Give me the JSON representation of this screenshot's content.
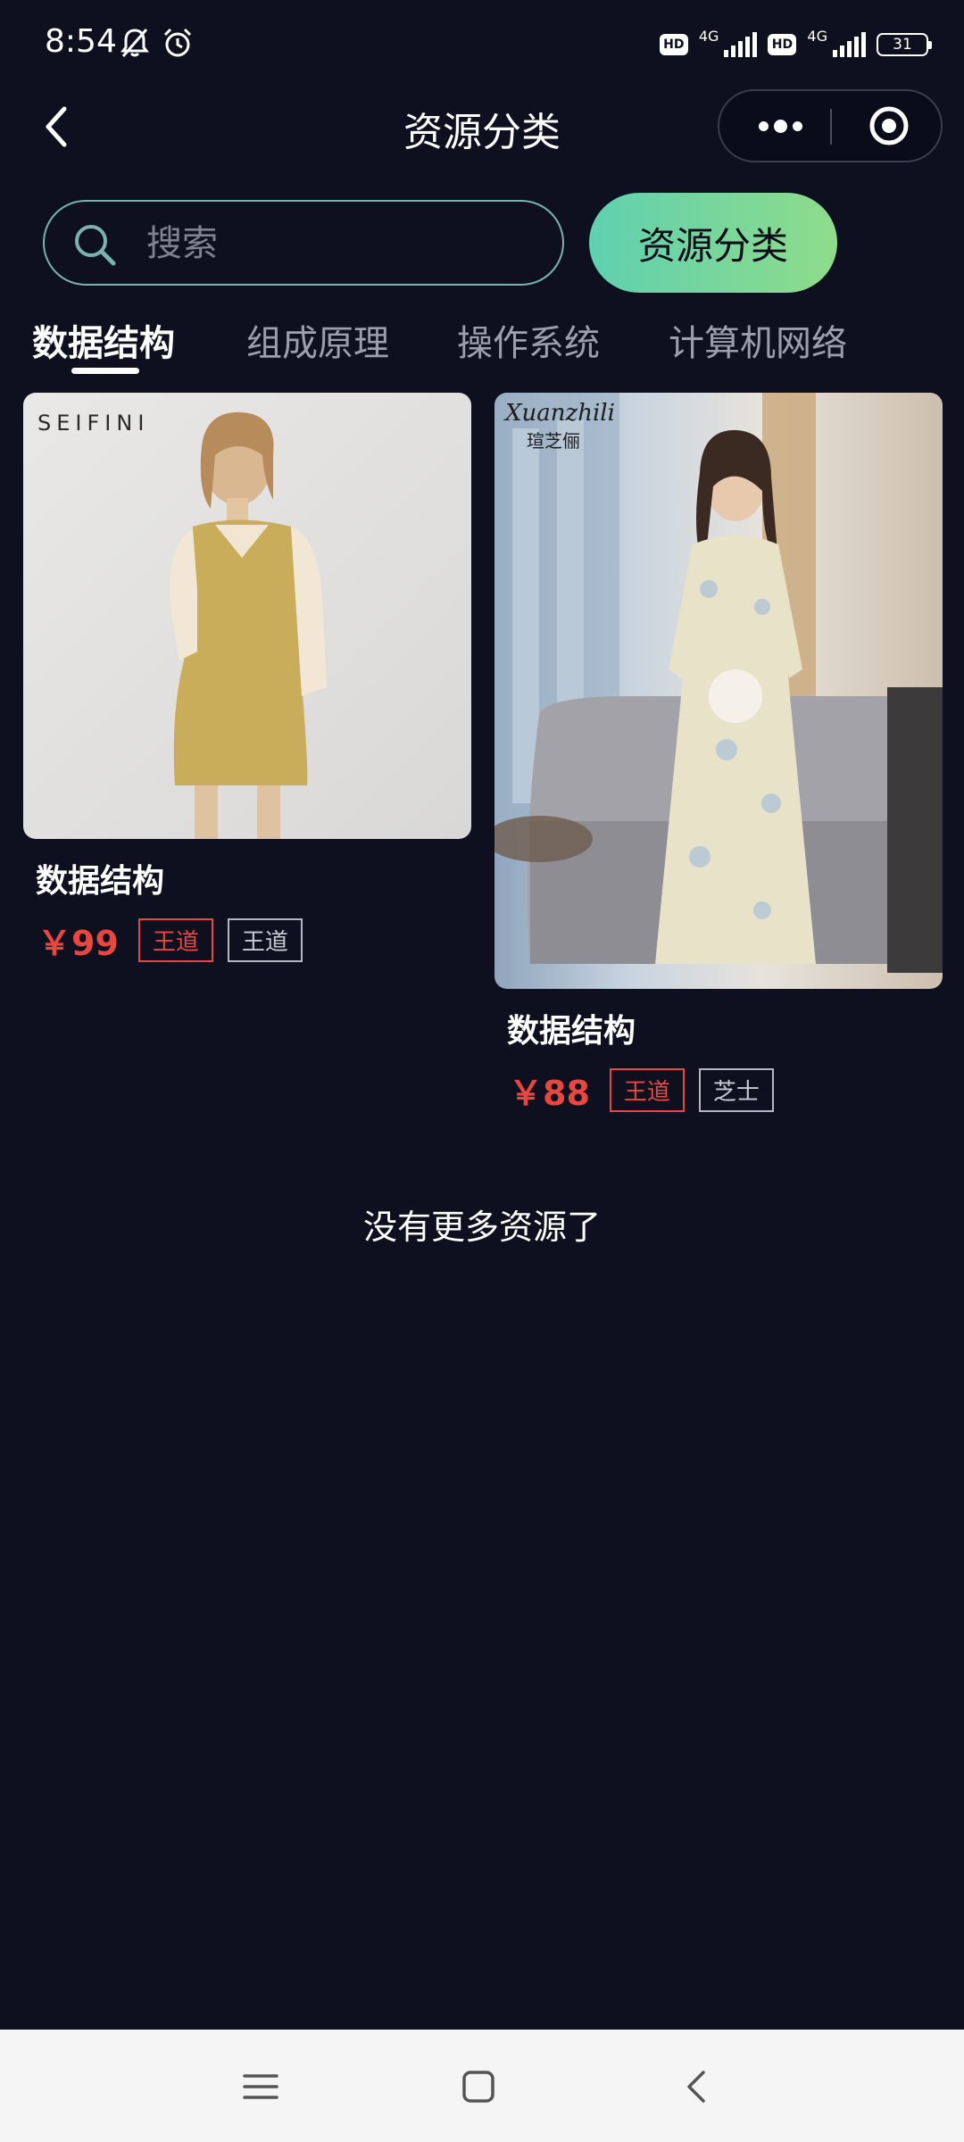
{
  "status_bar": {
    "time": "8:54",
    "network_1": "4G",
    "network_2": "4G",
    "hd_1": "HD",
    "hd_2": "HD",
    "battery": "31"
  },
  "nav": {
    "title": "资源分类"
  },
  "search": {
    "placeholder": "搜索",
    "button_label": "资源分类"
  },
  "tabs": [
    {
      "label": "数据结构",
      "active": true
    },
    {
      "label": "组成原理",
      "active": false
    },
    {
      "label": "操作系统",
      "active": false
    },
    {
      "label": "计算机网络",
      "active": false
    }
  ],
  "products": [
    {
      "brand": "SEIFINI",
      "title": "数据结构",
      "price": "￥99",
      "tags": [
        "王道",
        "王道"
      ]
    },
    {
      "brand": "Xuanzhili",
      "brand_sub": "瑄芝俪",
      "title": "数据结构",
      "price": "￥88",
      "tags": [
        "王道",
        "芝士"
      ]
    }
  ],
  "end_text": "没有更多资源了",
  "colors": {
    "background": "#0e1020",
    "accent_gradient_start": "#5fd0b0",
    "accent_gradient_end": "#8fdc8a",
    "price": "#e8473f"
  },
  "icons": {
    "nav_back": "chevron-left-icon",
    "capsule_more": "more-dots-icon",
    "capsule_close": "target-circle-icon",
    "search": "search-icon",
    "sys_menu": "menu-icon",
    "sys_home": "home-square-icon",
    "sys_back": "back-chevron-icon"
  }
}
